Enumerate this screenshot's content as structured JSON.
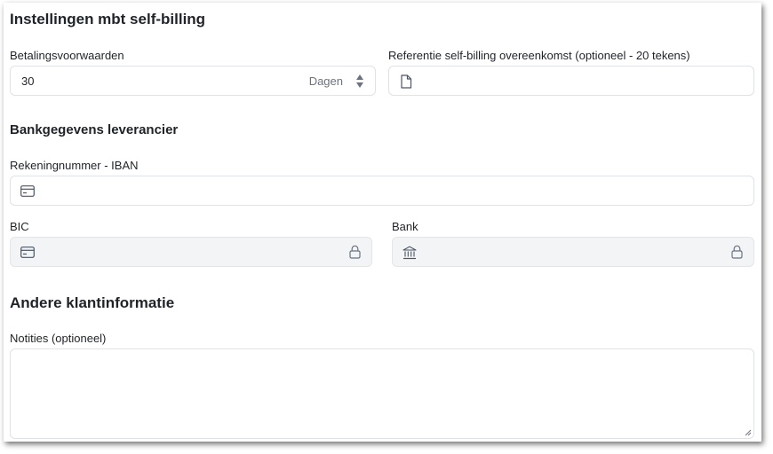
{
  "sections": {
    "selfbilling_title": "Instellingen mbt self-billing",
    "bank_title": "Bankgegevens leverancier",
    "other_title": "Andere klantinformatie"
  },
  "payment_terms": {
    "label": "Betalingsvoorwaarden",
    "value": "30",
    "unit": "Dagen"
  },
  "reference": {
    "label": "Referentie self-billing overeenkomst (optioneel - 20 tekens)",
    "value": ""
  },
  "iban": {
    "label": "Rekeningnummer - IBAN",
    "value": ""
  },
  "bic": {
    "label": "BIC",
    "value": ""
  },
  "bank": {
    "label": "Bank",
    "value": ""
  },
  "notes": {
    "label": "Notities (optioneel)",
    "value": ""
  },
  "icons": {
    "reference": "document-icon",
    "iban": "credit-card-icon",
    "bic": "credit-card-icon",
    "bank": "bank-icon",
    "lock": "lock-icon",
    "stepper": "stepper-arrows-icon"
  },
  "colors": {
    "text": "#1f2328",
    "muted": "#6b7280",
    "border": "#dfe2e6",
    "locked_bg": "#f3f4f6"
  }
}
